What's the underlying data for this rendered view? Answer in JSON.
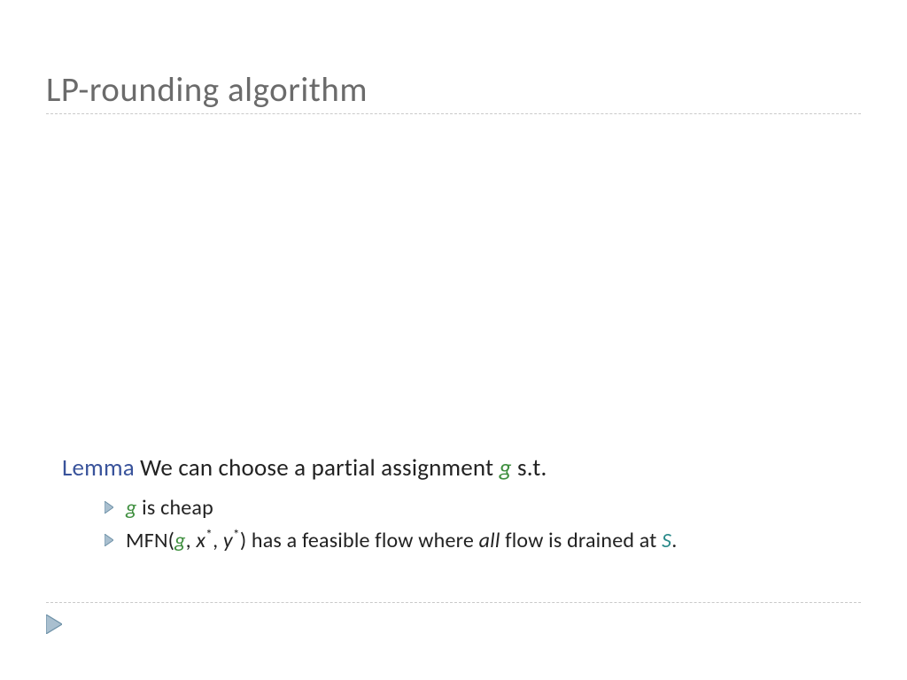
{
  "title": "LP-rounding algorithm",
  "lemma": {
    "label": "Lemma",
    "before_g": " We can choose a partial assignment ",
    "g": "g",
    "after_g": " s.t."
  },
  "bullet1": {
    "g": "g",
    "rest": " is cheap"
  },
  "bullet2": {
    "pre": "MFN(",
    "g": "g",
    "comma1": ", ",
    "x": "x",
    "star": "*",
    "comma2": ", ",
    "y": "y",
    "close": ") has a feasible flow where ",
    "all": "all",
    "tail": " flow is drained at ",
    "S": "S",
    "period": "."
  },
  "colors": {
    "title": "#6b6b6b",
    "lemma": "#39539b",
    "g": "#3f8f3f",
    "S": "#2a8a8a",
    "arrow_fill": "#a9bfcf",
    "arrow_stroke": "#6f92a8"
  }
}
